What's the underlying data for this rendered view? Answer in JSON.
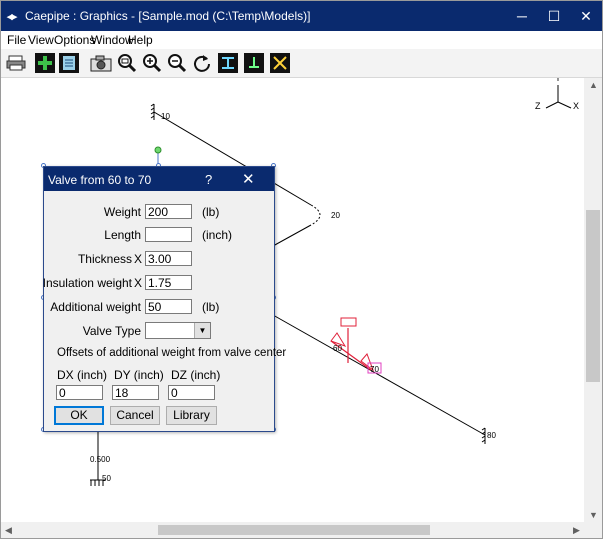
{
  "window": {
    "title": "Caepipe : Graphics -  [Sample.mod (C:\\Temp\\Models)]",
    "minimize": "─",
    "maximize": "☐",
    "close": "✕"
  },
  "menu": [
    {
      "label": "File"
    },
    {
      "label": "View"
    },
    {
      "label": "Options"
    },
    {
      "label": "Window"
    },
    {
      "label": "Help"
    }
  ],
  "toolbar": {
    "buttons": [
      "print-icon",
      "add-element-icon",
      "list-icon",
      "camera-icon",
      "zoom-window-icon",
      "zoom-in-icon",
      "zoom-out-icon",
      "rotate-icon",
      "view-xy-icon",
      "view-yz-icon",
      "view-zx-icon"
    ]
  },
  "graphics": {
    "axes": {
      "y": "Y",
      "x": "X",
      "z": "Z"
    },
    "nodes": {
      "n10": "10",
      "n20": "20",
      "n60": "60",
      "n70": "70",
      "n80": "80",
      "n50": "50",
      "len": "0.500"
    },
    "accent": "#e0203a"
  },
  "dialog": {
    "title": "Valve from 60 to 70",
    "help": "?",
    "close": "✕",
    "fields": {
      "weight": {
        "label": "Weight",
        "value": "200",
        "unit": "(lb)"
      },
      "length": {
        "label": "Length",
        "value": "",
        "unit": "(inch)"
      },
      "thickness": {
        "label": "Thickness",
        "mult": "X",
        "value": "3.00"
      },
      "insulation": {
        "label": "Insulation weight",
        "mult": "X",
        "value": "1.75"
      },
      "additional": {
        "label": "Additional weight",
        "value": "50",
        "unit": "(lb)"
      },
      "valve_type": {
        "label": "Valve Type",
        "value": ""
      }
    },
    "offsets_label": "Offsets of additional weight from valve center",
    "offsets": {
      "dx": {
        "label": "DX (inch)",
        "value": "0"
      },
      "dy": {
        "label": "DY (inch)",
        "value": "18"
      },
      "dz": {
        "label": "DZ (inch)",
        "value": "0"
      }
    },
    "buttons": {
      "ok": "OK",
      "cancel": "Cancel",
      "library": "Library"
    }
  }
}
